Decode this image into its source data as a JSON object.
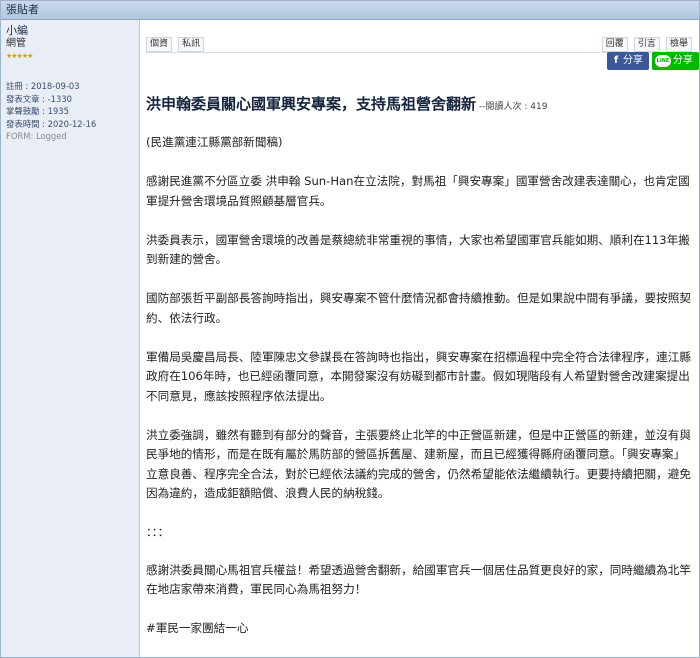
{
  "header": {
    "author_label": "張貼者"
  },
  "poster": {
    "name": "小編",
    "rank": "網管",
    "stars": "★★★★★",
    "stats": [
      "註冊 : 2018-09-03",
      "發表文章 : -1330",
      "掌聲鼓勵 : 1935",
      "發表時間 : 2020-12-16",
      "FORM: Logged"
    ]
  },
  "toolbar": {
    "left": [
      "個資",
      "私訊"
    ],
    "right": [
      "回覆",
      "引言",
      "檢舉"
    ]
  },
  "share": {
    "facebook": "分享",
    "facebook_icon": "f",
    "line": "分享",
    "line_icon": "LINE"
  },
  "post": {
    "title": "洪申翰委員關心國軍興安專案，支持馬祖營舍翻新",
    "views": "--閱讀人次 : 419",
    "paragraphs": [
      "(民進黨連江縣黨部新聞稿)",
      "感謝民進黨不分區立委 洪申翰 Sun-Han在立法院，對馬祖「興安專案」國軍營舍改建表達關心，也肯定國軍提升營舍環境品質照顧基層官兵。",
      "洪委員表示，國軍營舍環境的改善是蔡總統非常重視的事情，大家也希望國軍官兵能如期、順利在113年搬到新建的營舍。",
      "國防部張哲平副部長答詢時指出，興安專案不管什麼情況都會持續推動。但是如果說中間有爭議，要按照契約、依法行政。",
      "軍備局吳慶昌局長、陸軍陳忠文參謀長在答詢時也指出，興安專案在招標過程中完全符合法律程序，連江縣政府在106年時，也已經函覆同意，本開發案沒有妨礙到都市計畫。假如現階段有人希望對營舍改建案提出不同意見，應該按照程序依法提出。",
      "洪立委強調，雖然有聽到有部分的聲音，主張要終止北竿的中正營區新建，但是中正營區的新建，並沒有與民爭地的情形，而是在既有屬於馬防部的營區拆舊屋、建新屋，而且已經獲得縣府函覆同意。「興安專案」立意良善、程序完全合法，對於已經依法議約完成的營舍，仍然希望能依法繼續執行。更要持續把關，避免因為違約，造成鉅額賠償、浪費人民的納稅錢。",
      "：：：",
      "感謝洪委員關心馬祖官兵權益！希望透過營舍翻新，給國軍官兵一個居住品質更良好的家，同時繼續為北竿在地店家帶來消費，軍民同心為馬祖努力！",
      "#軍民一家團結一心"
    ]
  }
}
